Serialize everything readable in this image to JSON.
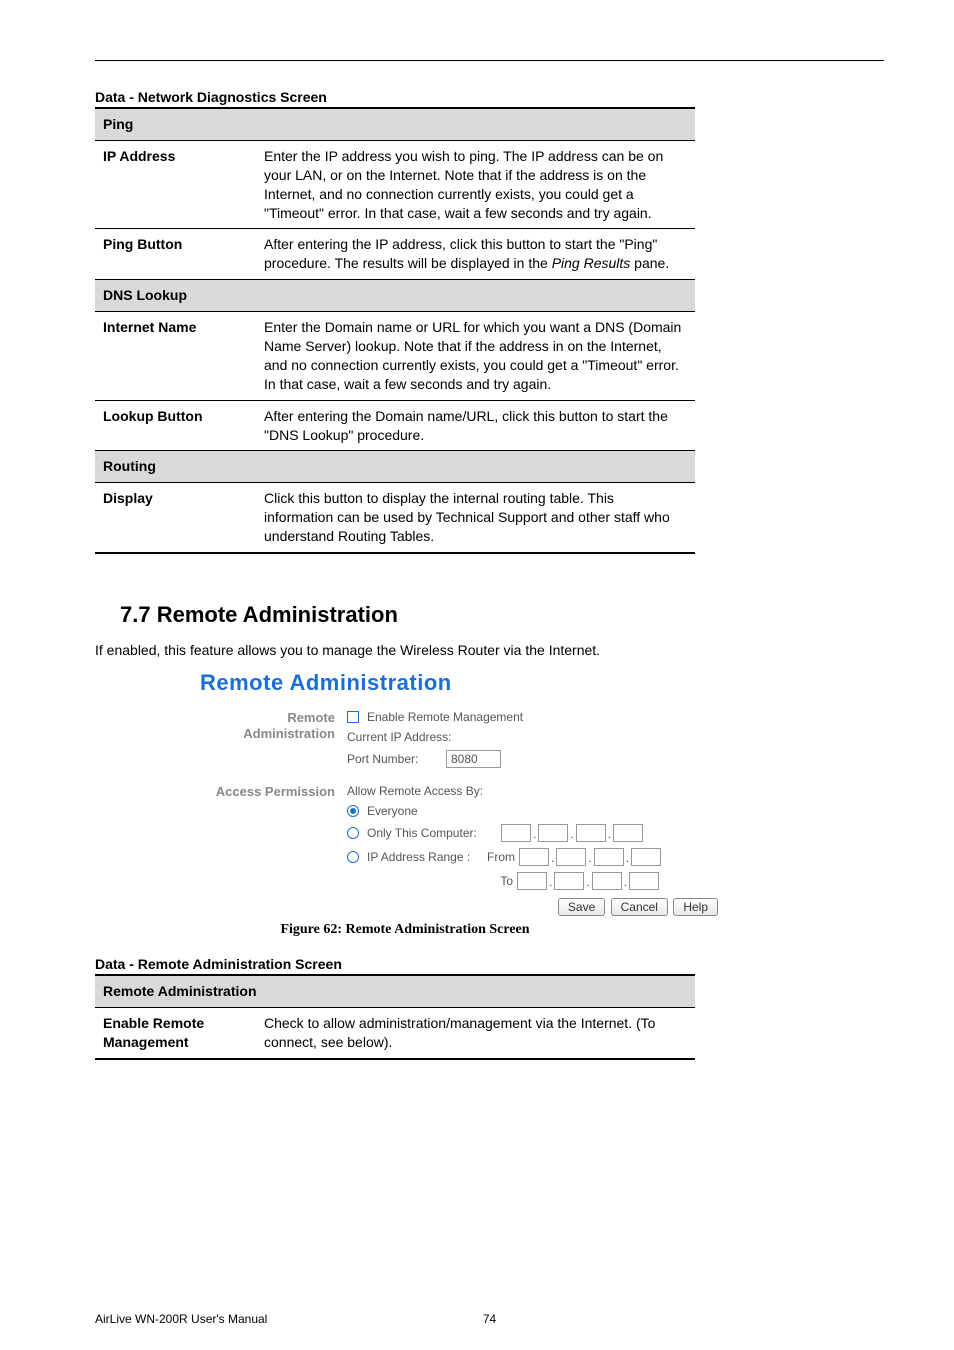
{
  "tables": {
    "diag": {
      "title": "Data - Network Diagnostics Screen",
      "sections": [
        {
          "header": "Ping",
          "rows": [
            {
              "label": "IP Address",
              "desc": "Enter the IP address you wish to ping. The IP address can be on your LAN, or on the Internet. Note that if the address is on the Internet, and no connection currently exists, you could get a \"Timeout\" error. In that case, wait a few seconds and try again."
            },
            {
              "label": "Ping Button",
              "desc_pre": "After entering the IP address, click this button to start the \"Ping\" procedure. The results will be displayed in the ",
              "desc_em": "Ping Results",
              "desc_post": " pane."
            }
          ]
        },
        {
          "header": "DNS Lookup",
          "rows": [
            {
              "label": "Internet Name",
              "desc": "Enter the Domain name or URL for which you want a DNS (Domain Name Server) lookup. Note that if the address in on the Internet, and no connection currently exists, you could get a \"Timeout\" error. In that case, wait a few seconds and try again."
            },
            {
              "label": "Lookup Button",
              "desc": "After entering the Domain name/URL, click this button to start the \"DNS Lookup\" procedure."
            }
          ]
        },
        {
          "header": "Routing",
          "rows": [
            {
              "label": "Display",
              "desc": "Click this button to display the internal routing table. This information can be used by Technical Support and other staff who understand Routing Tables."
            }
          ]
        }
      ]
    },
    "remote": {
      "title": "Data - Remote Administration Screen",
      "sections": [
        {
          "header": "Remote Administration",
          "rows": [
            {
              "label": "Enable Remote Management",
              "desc": "Check to allow administration/management via the Internet. (To connect, see below)."
            }
          ]
        }
      ]
    }
  },
  "section": {
    "heading": "7.7  Remote Administration",
    "intro": "If enabled, this feature allows you to manage the Wireless Router via the Internet."
  },
  "screenshot": {
    "title": "Remote Administration",
    "group1_label": "Remote Administration",
    "enable_label": "Enable Remote Management",
    "current_ip_label": "Current IP Address:",
    "port_label": "Port Number:",
    "port_value": "8080",
    "group2_label": "Access Permission",
    "allow_label": "Allow Remote Access By:",
    "opt_everyone": "Everyone",
    "opt_only_this": "Only This Computer:",
    "opt_range": "IP Address Range :",
    "from_label": "From",
    "to_label": "To",
    "btn_save": "Save",
    "btn_cancel": "Cancel",
    "btn_help": "Help"
  },
  "figure_caption": "Figure 62: Remote Administration Screen",
  "footer": {
    "left": "AirLive WN-200R User's Manual",
    "page": "74"
  }
}
